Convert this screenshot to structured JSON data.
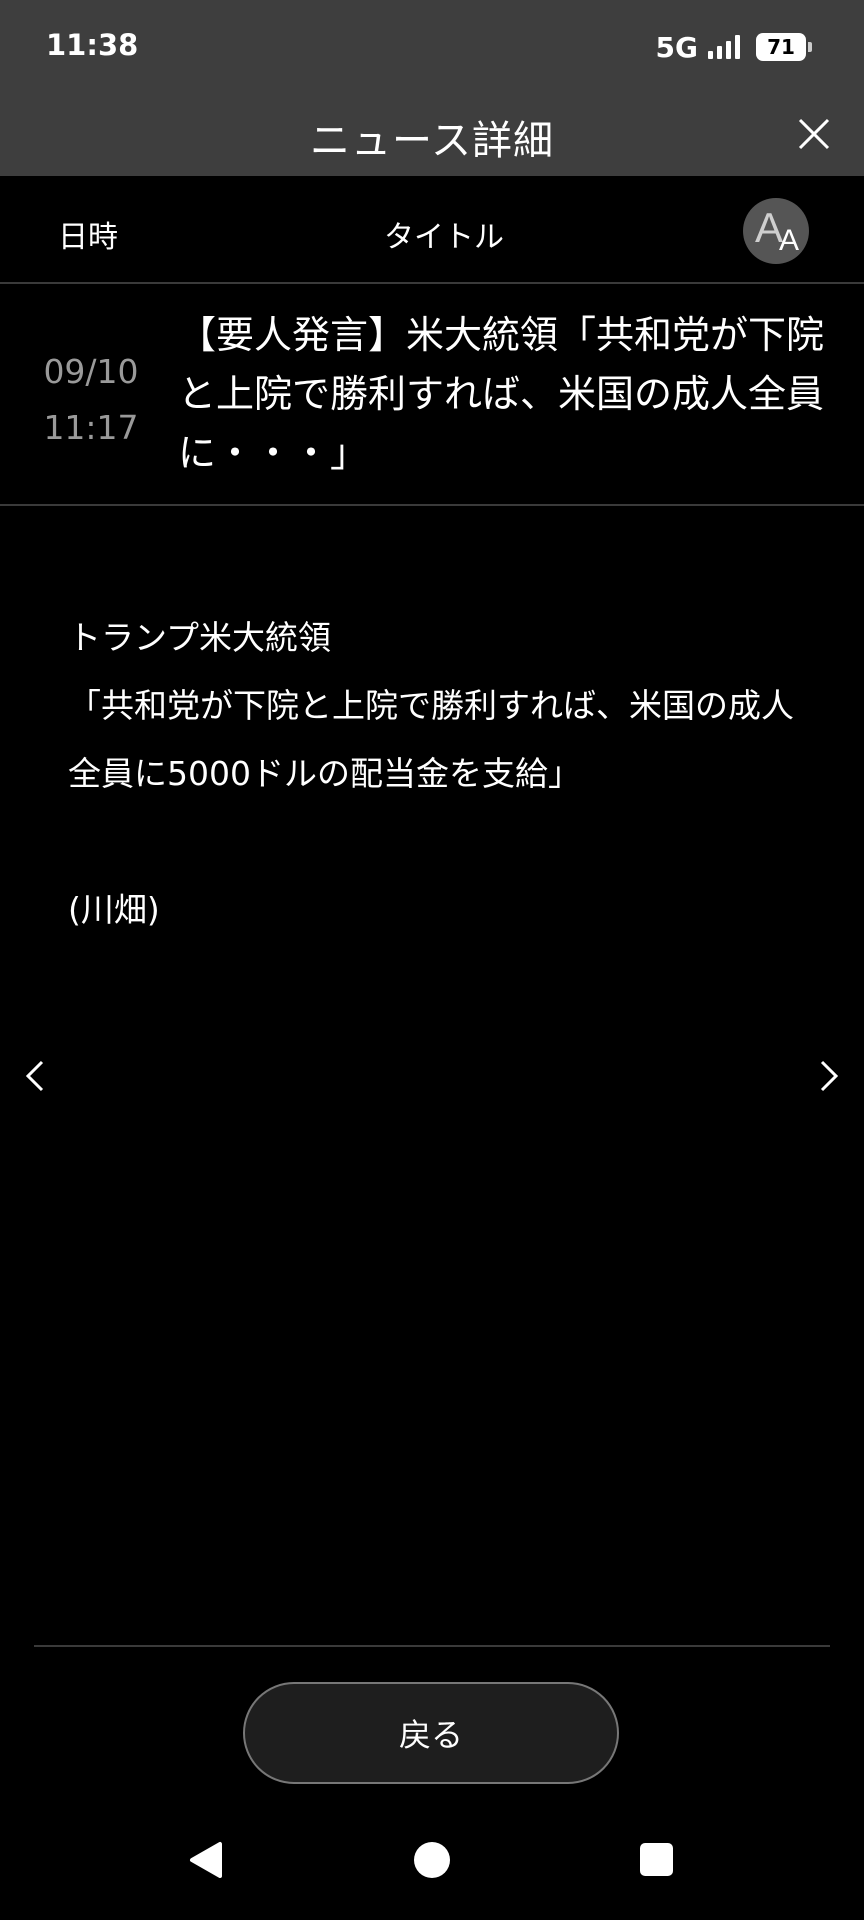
{
  "status_bar": {
    "time": "11:38",
    "network": "5G",
    "battery": "71"
  },
  "header": {
    "title": "ニュース詳細",
    "close_icon": "close-icon"
  },
  "columns": {
    "date_label": "日時",
    "title_label": "タイトル",
    "font_size_button": {
      "large": "A",
      "small": "A"
    }
  },
  "headline": {
    "date": "09/10",
    "time": "11:17",
    "title": "【要人発言】米大統領「共和党が下院と上院で勝利すれば、米国の成人全員に・・・」"
  },
  "article": {
    "lines": [
      "トランプ米大統領",
      "「共和党が下院と上院で勝利すれば、米国の成人全員に5000ドルの配当金を支給」"
    ],
    "byline": "(川畑)"
  },
  "navigation": {
    "prev_icon": "chevron-left-icon",
    "next_icon": "chevron-right-icon",
    "back_label": "戻る"
  },
  "system_nav": {
    "back_icon": "triangle-back-icon",
    "home_icon": "circle-home-icon",
    "recents_icon": "square-recents-icon"
  },
  "colors": {
    "header_bg": "#3e3e3e",
    "background": "#000000",
    "muted_text": "#9a9a9a"
  }
}
